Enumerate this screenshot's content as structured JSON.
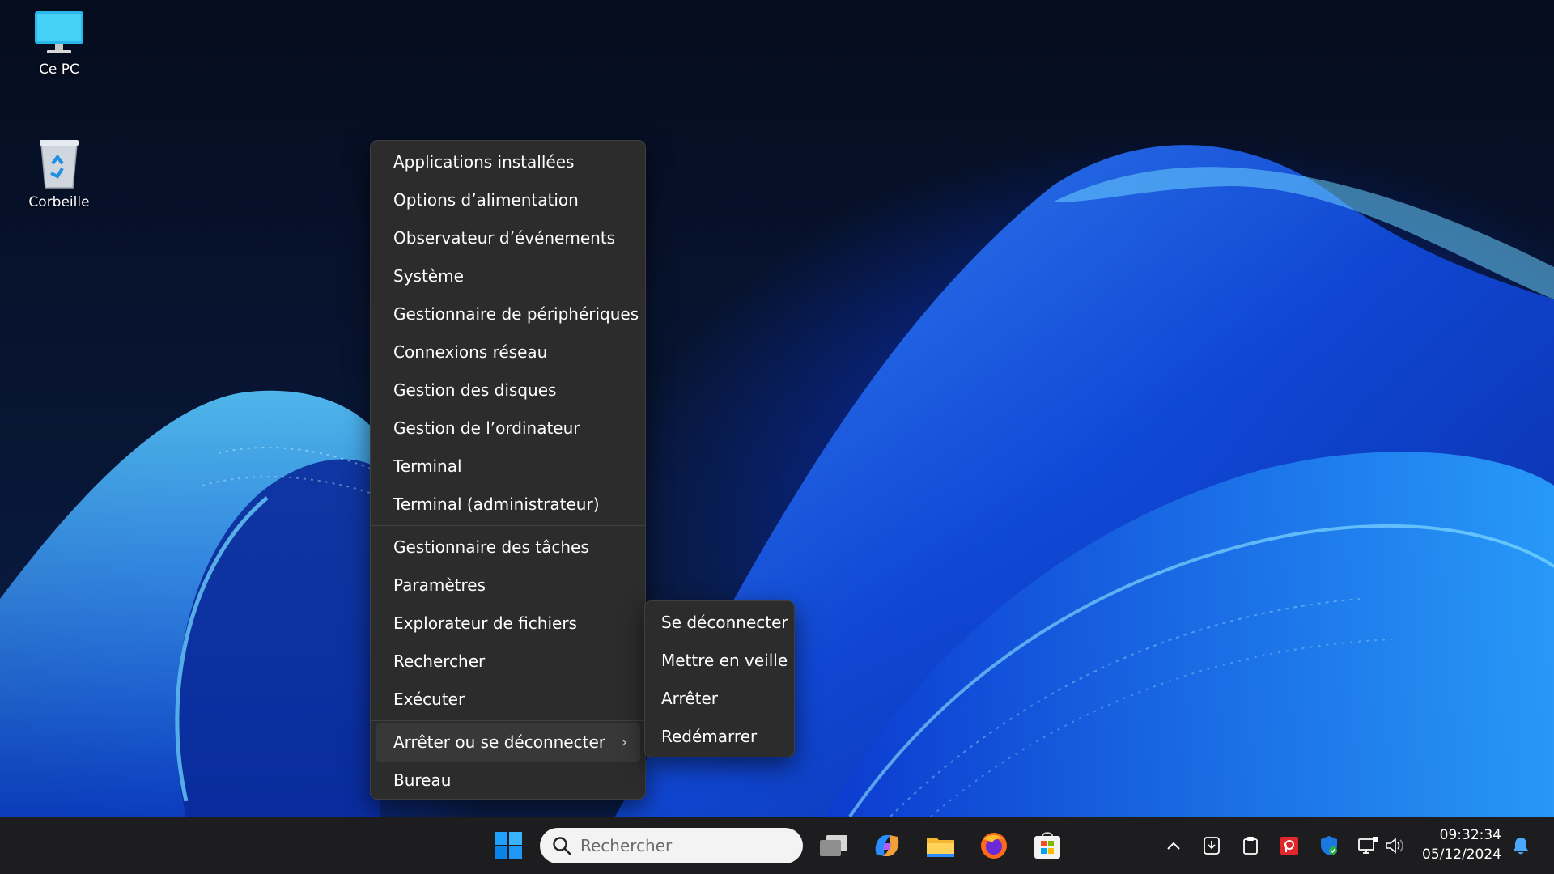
{
  "desktop": {
    "icons": [
      {
        "label": "Ce PC",
        "icon": "computer-icon"
      },
      {
        "label": "Corbeille",
        "icon": "recycle-bin-icon"
      }
    ]
  },
  "context_menu": {
    "group1": [
      "Applications installées",
      "Options d’alimentation",
      "Observateur d’événements",
      "Système",
      "Gestionnaire de périphériques",
      "Connexions réseau",
      "Gestion des disques",
      "Gestion de l’ordinateur",
      "Terminal",
      "Terminal (administrateur)"
    ],
    "group2": [
      "Gestionnaire des tâches",
      "Paramètres",
      "Explorateur de fichiers",
      "Rechercher",
      "Exécuter"
    ],
    "group3": [
      "Arrêter ou se déconnecter",
      "Bureau"
    ]
  },
  "submenu": {
    "items": [
      "Se déconnecter",
      "Mettre en veille",
      "Arrêter",
      "Redémarrer"
    ]
  },
  "taskbar": {
    "search_placeholder": "Rechercher",
    "apps": [
      "start-icon",
      "task-view-icon",
      "copilot-icon",
      "file-explorer-icon",
      "firefox-icon",
      "microsoft-store-icon"
    ],
    "tray": [
      "chevron-up-icon",
      "download-icon",
      "clipboard-icon",
      "pdf-app-icon",
      "windows-security-icon",
      "network-icon",
      "volume-icon",
      "notification-bell-icon"
    ],
    "time": "09:32:34",
    "date": "05/12/2024"
  },
  "colors": {
    "menu_bg": "#2c2c2c",
    "taskbar_bg": "#1d1d1f",
    "accent": "#0a74da"
  }
}
